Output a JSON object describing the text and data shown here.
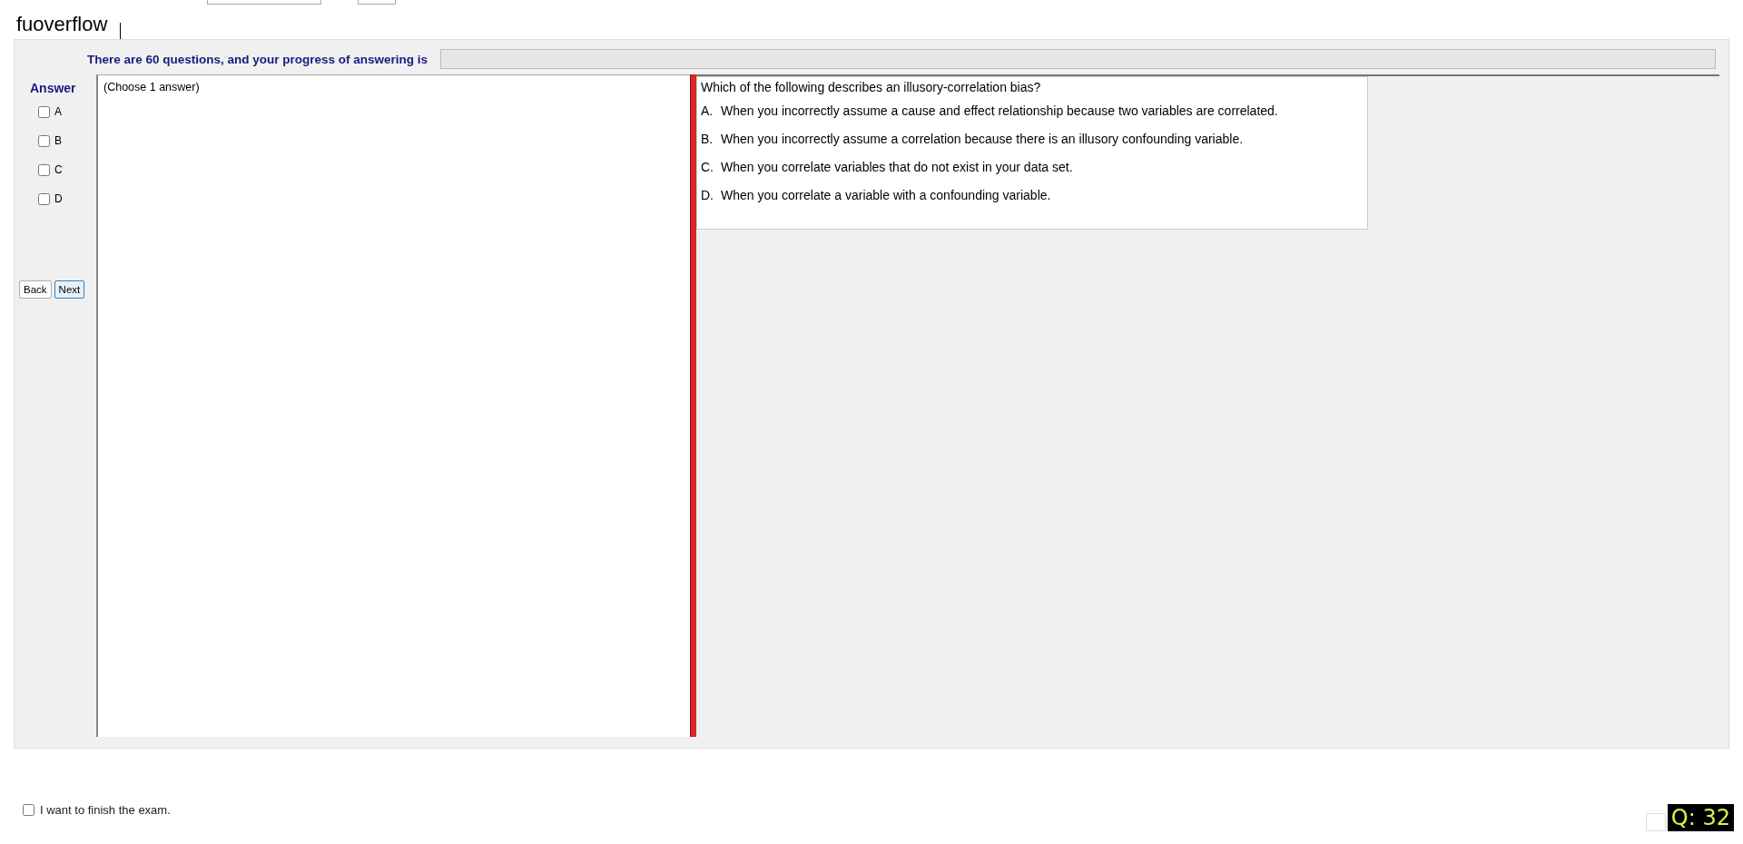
{
  "brand": "fuoverflow",
  "progress": {
    "label": "There are 60 questions, and your progress of answering is",
    "level": 0
  },
  "answer": {
    "title": "Answer",
    "options": [
      {
        "label": "A",
        "checked": false
      },
      {
        "label": "B",
        "checked": false
      },
      {
        "label": "C",
        "checked": false
      },
      {
        "label": "D",
        "checked": false
      }
    ]
  },
  "buttons": [
    {
      "label": "Back",
      "selected": false
    },
    {
      "label": "Next",
      "selected": true
    }
  ],
  "instruction": "(Choose 1 answer)",
  "question": {
    "text": "Which of the following describes an illusory-correlation bias?",
    "choices": [
      {
        "letter": "A.",
        "text": "When you incorrectly assume a cause and effect relationship because two variables are correlated."
      },
      {
        "letter": "B.",
        "text": "When you incorrectly assume a correlation because there is an illusory confounding variable."
      },
      {
        "letter": "C.",
        "text": "When you correlate variables that do not exist in your data set."
      },
      {
        "letter": "D.",
        "text": "When you correlate a variable with a confounding variable."
      }
    ]
  },
  "finish": {
    "label": "I want to finish the exam.",
    "checked": false
  },
  "counter": "Q: 32"
}
